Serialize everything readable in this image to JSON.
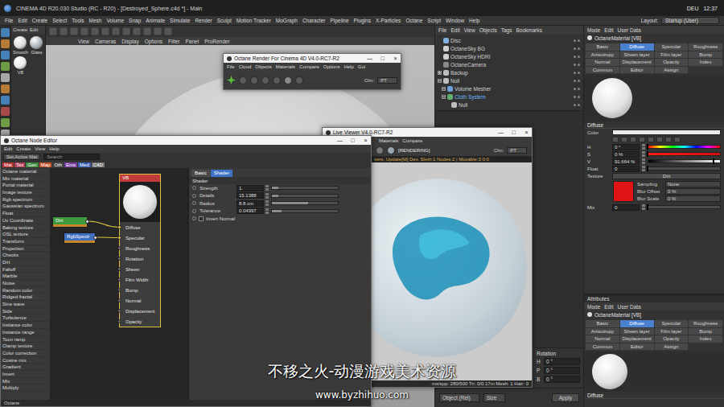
{
  "window": {
    "title": "CINEMA 4D R20.030 Studio (RC - R20) - [Destroyed_Sphere.c4d *] - Main",
    "controls": [
      "—",
      "□",
      "×"
    ]
  },
  "tray": {
    "language": "DEU",
    "time": "12:37"
  },
  "menu": [
    "File",
    "Edit",
    "Create",
    "Select",
    "Tools",
    "Mesh",
    "Volume",
    "Snap",
    "Animate",
    "Simulate",
    "Render",
    "Sculpt",
    "Motion Tracker",
    "MoGraph",
    "Character",
    "Pipeline",
    "Plugins",
    "X-Particles",
    "Octane",
    "Script",
    "Window",
    "Help"
  ],
  "layout": {
    "label": "Layout:",
    "value": "Startup (User)"
  },
  "content_browser": {
    "menu": [
      "Create",
      "Edit"
    ],
    "materials": [
      {
        "name": "Smooth",
        "color": "#dcdcdc"
      },
      {
        "name": "Glass",
        "color": "#a9b3b8"
      },
      {
        "name": "VB",
        "color": "#eaeaea"
      }
    ]
  },
  "viewport": {
    "menu": [
      "View",
      "Cameras",
      "Display",
      "Options",
      "Filter",
      "Panel",
      "ProRender"
    ]
  },
  "octane_render": {
    "title": "Octane Render For Cinema 4D V4.0-RC7-R2",
    "menu": [
      "File",
      "Cloud",
      "Objects",
      "Materials",
      "Compare",
      "Options",
      "Help",
      "Gui"
    ],
    "channel_label": "Chn:",
    "channel": "PT"
  },
  "node_editor": {
    "title": "Octane Node Editor",
    "menu": [
      "Edit",
      "Create",
      "View",
      "Help"
    ],
    "active_mat": "Set Active Mat",
    "search": "Search",
    "categories": [
      {
        "label": "Mat",
        "color": "#b83232"
      },
      {
        "label": "Tex",
        "color": "#b0405a"
      },
      {
        "label": "Gen",
        "color": "#3d8a3d"
      },
      {
        "label": "Map",
        "color": "#c0502a"
      },
      {
        "label": "Oth",
        "color": "#444444"
      },
      {
        "label": "Ems",
        "color": "#7a3fa0"
      },
      {
        "label": "Med",
        "color": "#3a5fb0"
      },
      {
        "label": "C4D",
        "color": "#777777"
      }
    ],
    "node_types": [
      "Octane material",
      "Mix material",
      "Portal material",
      "Image texture",
      "Rgb spectrum",
      "Gaussian spectrum",
      "Float",
      "Uv Coordinate",
      "Baking texture",
      "OSL texture",
      "Transform",
      "Projection",
      "Checks",
      "Dirt",
      "Falloff",
      "Marble",
      "Noise",
      "Random color",
      "Ridged fractal",
      "Sine wave",
      "Side",
      "Turbulence",
      "Instance color",
      "Instance range",
      "Toon ramp",
      "Clamp texture",
      "Color correction",
      "Cosine mix",
      "Gradient",
      "Invert",
      "Mix",
      "Multiply"
    ],
    "nodes": [
      {
        "name": "Dirt",
        "kind": "texture",
        "color": "#3f9a3f"
      },
      {
        "name": "RgbSpectr",
        "kind": "texture",
        "color": "#3f6fc0"
      },
      {
        "name": "VB",
        "kind": "material",
        "color": "#c23b3b",
        "pins": [
          {
            "name": "Diffuse",
            "connected": true
          },
          {
            "name": "Specular",
            "connected": true
          },
          {
            "name": "Roughness",
            "connected": false
          },
          {
            "name": "Rotation",
            "connected": false
          },
          {
            "name": "Sheen",
            "connected": false
          },
          {
            "name": "Film Width",
            "connected": false
          },
          {
            "name": "Bump",
            "connected": false
          },
          {
            "name": "Normal",
            "connected": false
          },
          {
            "name": "Displacement",
            "connected": false
          },
          {
            "name": "Opacity",
            "connected": false
          }
        ]
      }
    ],
    "links": [
      {
        "from": "Dirt",
        "to": "Diffuse"
      },
      {
        "from": "RgbSpectr",
        "to": "Specular"
      }
    ],
    "properties": {
      "tabs": [
        {
          "label": "Basic",
          "selected": false
        },
        {
          "label": "Shader",
          "selected": true
        }
      ],
      "section": "Shader",
      "params": [
        {
          "kind": "slider",
          "label": "Strength",
          "value": "1.",
          "level": 0.1
        },
        {
          "kind": "slider",
          "label": "Details",
          "value": "15.1388",
          "level": 0.1
        },
        {
          "kind": "slider",
          "label": "Radius",
          "value": "8.8 cm",
          "level": 0.55
        },
        {
          "kind": "slider",
          "label": "Tolerance",
          "value": "0.04997",
          "level": 0.15
        },
        {
          "kind": "checkbox",
          "label": "Invert Normal",
          "checked": false
        }
      ]
    },
    "status": "Octane"
  },
  "live_viewer": {
    "title": "Live Viewer V4.0-RC7-R2",
    "menu": [
      "Materials",
      "Compare"
    ],
    "state": "[RENDERING]",
    "channel_label": "Chn:",
    "channel": "PT",
    "info": "vers. Update[M] Dev. Sleth:1 Nodes:2 | Movable:3 0:0",
    "stats": "ms/spp: 280/500 Tri: 0/0.17m Mesh: 1 Hair: 0"
  },
  "object_manager": {
    "menu": [
      "File",
      "Edit",
      "View",
      "Objects",
      "Tags",
      "Bookmarks"
    ],
    "objects": [
      {
        "name": "Disc",
        "kind": "disc",
        "depth": 0,
        "collapsible": false,
        "expanded": false,
        "selected": false
      },
      {
        "name": "OctaneSky BG",
        "kind": "sky",
        "depth": 0,
        "collapsible": false,
        "expanded": false,
        "selected": false
      },
      {
        "name": "OctaneSky HDRI",
        "kind": "sky",
        "depth": 0,
        "collapsible": false,
        "expanded": false,
        "selected": false
      },
      {
        "name": "OctaneCamera",
        "kind": "camera",
        "depth": 0,
        "collapsible": false,
        "expanded": false,
        "selected": false
      },
      {
        "name": "Backup",
        "kind": "null",
        "depth": 0,
        "collapsible": true,
        "expanded": false,
        "selected": false
      },
      {
        "name": "Null",
        "kind": "null",
        "depth": 0,
        "collapsible": true,
        "expanded": true,
        "selected": false
      },
      {
        "name": "Volume Mesher",
        "kind": "mesher",
        "depth": 1,
        "collapsible": true,
        "expanded": true,
        "selected": false
      },
      {
        "name": "Cloth System",
        "kind": "cloth",
        "depth": 1,
        "collapsible": true,
        "expanded": true,
        "selected": true
      },
      {
        "name": "Null",
        "kind": "null",
        "depth": 2,
        "collapsible": false,
        "expanded": false,
        "selected": false
      }
    ]
  },
  "coordinates": {
    "heading": "Rotation",
    "rows": [
      {
        "axis": "H",
        "value": "0 °"
      },
      {
        "axis": "P",
        "value": "0 °"
      },
      {
        "axis": "B",
        "value": "0 °"
      }
    ],
    "mode": "Object (Rel)",
    "size": "Size",
    "apply": "Apply"
  },
  "attributes": {
    "menu": [
      "Mode",
      "Edit",
      "User Data"
    ],
    "name": "OctaneMaterial [VB]",
    "tabs": [
      {
        "label": "Basic",
        "selected": false
      },
      {
        "label": "Diffuse",
        "selected": true
      },
      {
        "label": "Specular",
        "selected": false
      },
      {
        "label": "Roughness",
        "selected": false
      },
      {
        "label": "Anisotropy",
        "selected": false
      },
      {
        "label": "Sheen layer",
        "selected": false
      },
      {
        "label": "Film layer",
        "selected": false
      },
      {
        "label": "Bump",
        "selected": false
      },
      {
        "label": "Normal",
        "selected": false
      },
      {
        "label": "Displacement",
        "selected": false
      },
      {
        "label": "Opacity",
        "selected": false
      },
      {
        "label": "Index",
        "selected": false
      },
      {
        "label": "Common",
        "selected": false
      },
      {
        "label": "Editor",
        "selected": false
      },
      {
        "label": "Assign",
        "selected": false
      }
    ],
    "section": "Diffuse",
    "color": {
      "label": "Color",
      "value": "#eaeaea"
    },
    "hsv": [
      {
        "label": "H",
        "value": "0 °",
        "level": 0,
        "kind": "hue"
      },
      {
        "label": "S",
        "value": "0 %",
        "level": 0,
        "kind": "saturation"
      },
      {
        "label": "V",
        "value": "91.664 %",
        "level": 0.917,
        "kind": "value"
      }
    ],
    "float": {
      "label": "Float",
      "value": "0",
      "level": 0
    },
    "texture": {
      "label": "Texture",
      "value": "Dirt",
      "options": [
        {
          "label": "Sampling",
          "value": "None"
        },
        {
          "label": "Blur Offset",
          "value": "0 %"
        },
        {
          "label": "Blur Scale",
          "value": "0 %"
        }
      ]
    },
    "mix": {
      "label": "Mix",
      "value": "0",
      "level": 0
    }
  },
  "attributes_lower": {
    "title": "Attributes",
    "section": "Diffuse"
  },
  "watermark": {
    "text": "不移之火-动漫游戏美术资源",
    "url": "www.byzhihuo.com"
  }
}
